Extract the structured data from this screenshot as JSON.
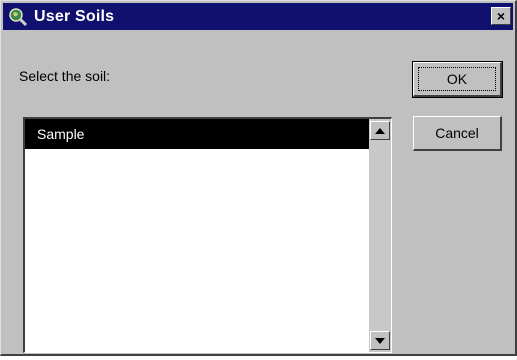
{
  "window": {
    "title": "User Soils",
    "title_icon": "globe-magnifier-icon",
    "close_label": "×"
  },
  "prompt": "Select the soil:",
  "list": {
    "items": [
      {
        "label": "Sample",
        "selected": true
      }
    ]
  },
  "buttons": {
    "ok_label": "OK",
    "cancel_label": "Cancel"
  },
  "colors": {
    "titlebar": "#10106e",
    "face": "#c0c0c0",
    "selection": "#000000"
  }
}
